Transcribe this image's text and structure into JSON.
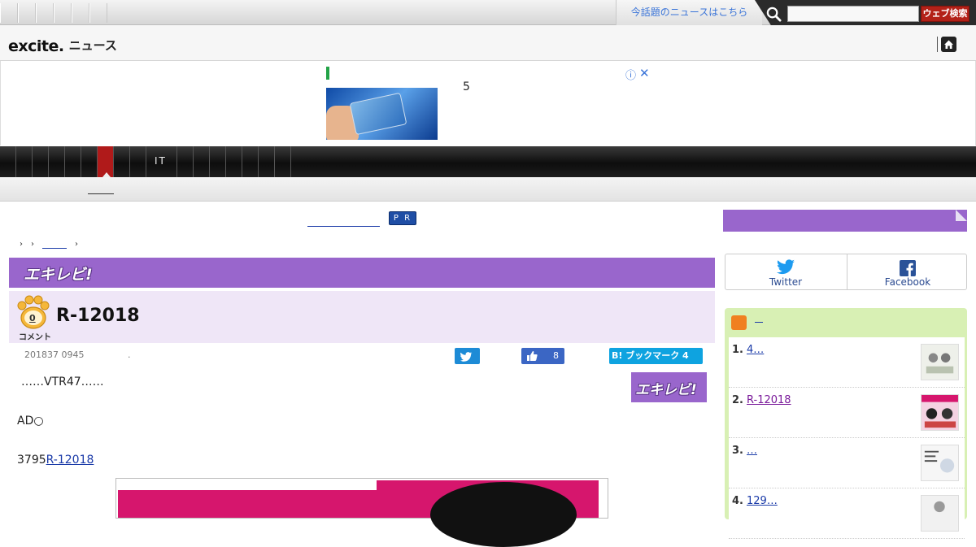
{
  "topbar": {
    "trending_label": "今話題のニュースはこちら",
    "search_button": "ウェブ検索",
    "search_placeholder": ""
  },
  "header": {
    "brand": "excite.",
    "section": "ニュース"
  },
  "ad": {
    "text": "5",
    "info_glyph": "ⓘ",
    "close_glyph": "✕"
  },
  "nav": {
    "active_index": 6,
    "it_label": "IT"
  },
  "pr_badge": "P R",
  "breadcrumb": [
    "›",
    "›",
    "›"
  ],
  "category": {
    "name": "エキレビ!",
    "color": "#9966cc"
  },
  "article": {
    "comment_count": "0",
    "comment_label": "コメント",
    "title": "R-12018",
    "date": "201837 0945",
    "date_suffix": ".",
    "like_count": "8",
    "hatena_label": "B! ブックマーク 4",
    "side_logo": "エキレビ!",
    "paragraph1": "……VTR47……",
    "paragraph2": "AD○",
    "paragraph3_prefix": "3795",
    "paragraph3_link": "R-12018"
  },
  "sidebar": {
    "social": {
      "twitter": "Twitter",
      "facebook": "Facebook"
    },
    "ranking": {
      "header_link": "",
      "items": [
        {
          "num": "1.",
          "text": "4…",
          "color": "#1a3aa8"
        },
        {
          "num": "2.",
          "text": "R-12018",
          "color": "#7a1a9a"
        },
        {
          "num": "3.",
          "text": "…",
          "color": "#1a3aa8"
        },
        {
          "num": "4.",
          "text": "129…",
          "color": "#1a3aa8"
        }
      ]
    }
  },
  "colors": {
    "accent_purple": "#9966cc",
    "search_button": "#b32118",
    "link": "#1a3aa8",
    "nav_active": "#b01a1a"
  }
}
